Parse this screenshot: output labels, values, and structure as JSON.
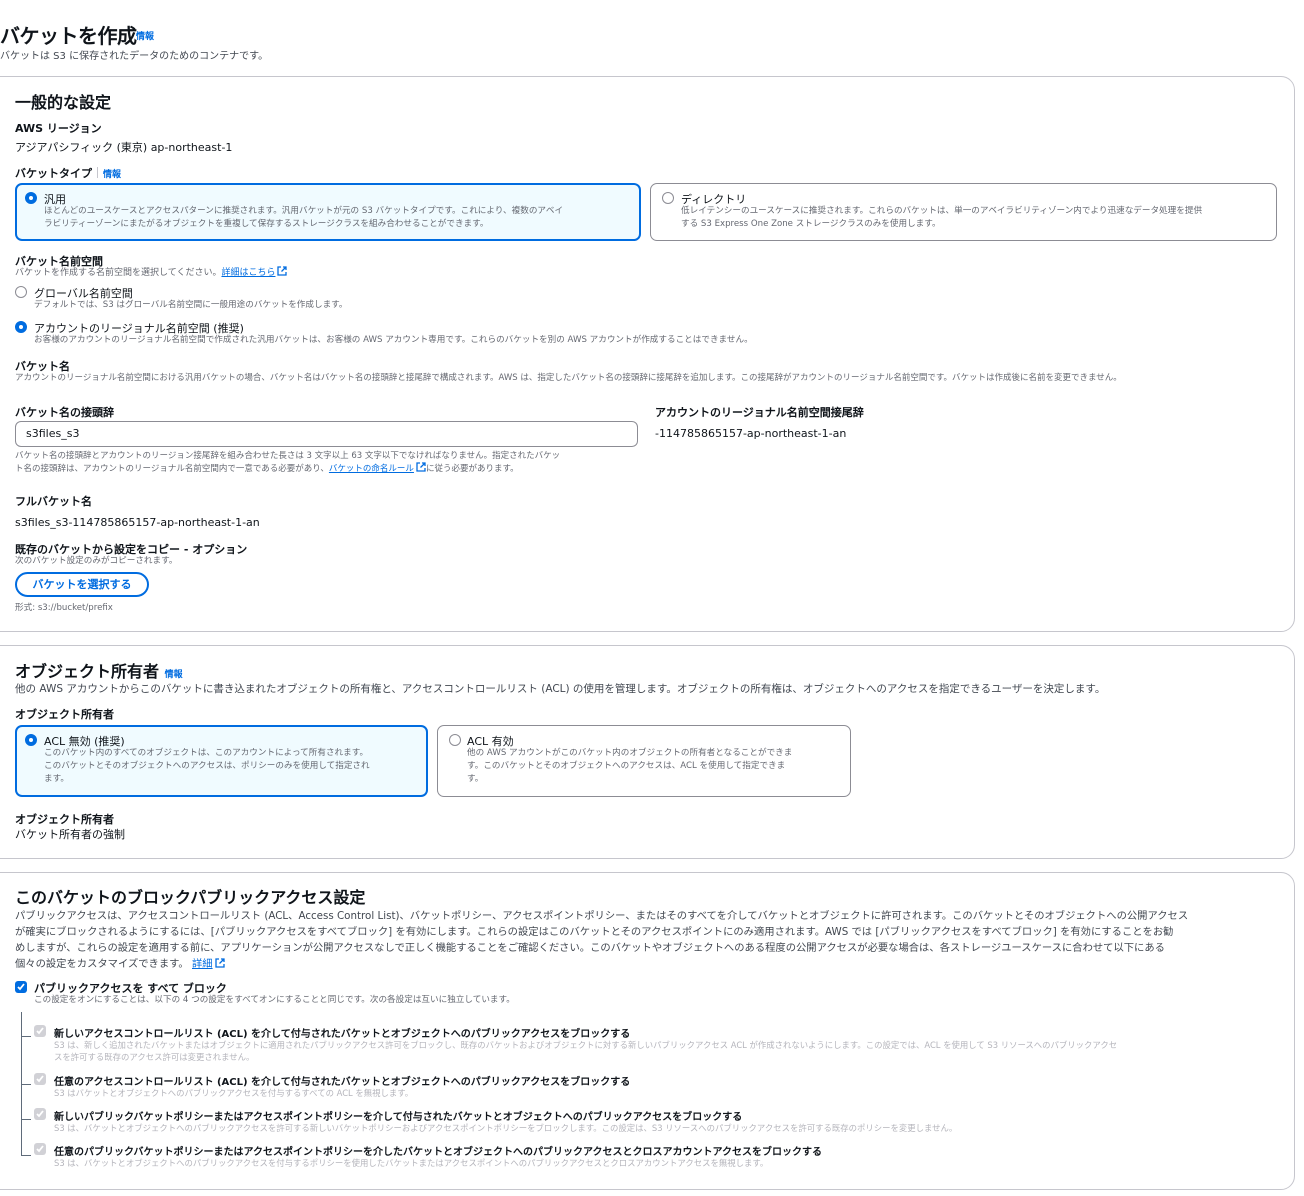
{
  "page": {
    "title": "バケットを作成",
    "info": "情報",
    "subtitle": "バケットは S3 に保存されたデータのためのコンテナです。"
  },
  "general": {
    "heading": "一般的な設定",
    "region_label": "AWS リージョン",
    "region_value": "アジアパシフィック (東京) ap-northeast-1",
    "bucket_type_label": "バケットタイプ",
    "bucket_type_info": "情報",
    "type_general": {
      "title": "汎用",
      "desc1": "ほとんどのユースケースとアクセスパターンに推奨されます。汎用バケットが元の S3 バケットタイプです。これにより、複数のアベイ",
      "desc2": "ラビリティーゾーンにまたがるオブジェクトを重複して保存するストレージクラスを組み合わせることができます。"
    },
    "type_directory": {
      "title": "ディレクトリ",
      "desc1": "低レイテンシーのユースケースに推奨されます。これらのバケットは、単一のアベイラビリティゾーン内でより迅速なデータ処理を提供",
      "desc2": "する S3 Express One Zone ストレージクラスのみを使用します。"
    },
    "namespace_label": "バケット名前空間",
    "namespace_desc": "バケットを作成する名前空間を選択してください。",
    "namespace_link": "詳細はこちら",
    "ns_global_title": "グローバル名前空間",
    "ns_global_desc": "デフォルトでは、S3 はグローバル名前空間に一般用途のバケットを作成します。",
    "ns_account_title": "アカウントのリージョナル名前空間 (推奨)",
    "ns_account_desc": "お客様のアカウントのリージョナル名前空間で作成された汎用バケットは、お客様の AWS アカウント専用です。これらのバケットを別の AWS アカウントが作成することはできません。",
    "bucket_name_label": "バケット名",
    "bucket_name_desc": "アカウントのリージョナル名前空間における汎用バケットの場合、バケット名はバケット名の接頭辞と接尾辞で構成されます。AWS は、指定したバケット名の接頭辞に接尾辞を追加します。この接尾辞がアカウントのリージョナル名前空間です。バケットは作成後に名前を変更できません。",
    "prefix_label": "バケット名の接頭辞",
    "prefix_value": "s3files_s3",
    "prefix_help1": "バケット名の接頭辞とアカウントのリージョン接尾辞を組み合わせた長さは 3 文字以上 63 文字以下でなければなりません。指定されたバケッ",
    "prefix_help2a": "ト名の接頭辞は、アカウントのリージョナル名前空間内で一意である必要があり、",
    "prefix_help_link": "バケットの命名ルール",
    "prefix_help2b": "に従う必要があります。",
    "suffix_label": "アカウントのリージョナル名前空間接尾辞",
    "suffix_value": "-114785865157-ap-northeast-1-an",
    "full_name_label": "フルバケット名",
    "full_name_value": "s3files_s3-114785865157-ap-northeast-1-an",
    "copy_label": "既存のバケットから設定をコピー - オプション",
    "copy_desc": "次のバケット設定のみがコピーされます。",
    "choose_bucket_button": "バケットを選択する",
    "format_hint": "形式: s3://bucket/prefix"
  },
  "ownership": {
    "heading": "オブジェクト所有者",
    "info": "情報",
    "desc": "他の AWS アカウントからこのバケットに書き込まれたオブジェクトの所有権と、アクセスコントロールリスト (ACL) の使用を管理します。オブジェクトの所有権は、オブジェクトへのアクセスを指定できるユーザーを決定します。",
    "label": "オブジェクト所有者",
    "acl_disabled": {
      "title": "ACL 無効 (推奨)",
      "desc1": "このバケット内のすべてのオブジェクトは、このアカウントによって所有されます。",
      "desc2": "このバケットとそのオブジェクトへのアクセスは、ポリシーのみを使用して指定され",
      "desc3": "ます。"
    },
    "acl_enabled": {
      "title": "ACL 有効",
      "desc1": "他の AWS アカウントがこのバケット内のオブジェクトの所有者となることができま",
      "desc2": "す。このバケットとそのオブジェクトへのアクセスは、ACL を使用して指定できま",
      "desc3": "す。"
    },
    "owner_label": "オブジェクト所有者",
    "owner_value": "バケット所有者の強制"
  },
  "block": {
    "heading": "このバケットのブロックパブリックアクセス設定",
    "desc1": "パブリックアクセスは、アクセスコントロールリスト (ACL、Access Control List)、バケットポリシー、アクセスポイントポリシー、またはそのすべてを介してバケットとオブジェクトに許可されます。このバケットとそのオブジェクトへの公開アクセス",
    "desc2": "が確実にブロックされるようにするには、[パブリックアクセスをすべてブロック] を有効にします。これらの設定はこのバケットとそのアクセスポイントにのみ適用されます。AWS では [パブリックアクセスをすべてブロック] を有効にすることをお勧",
    "desc3": "めしますが、これらの設定を適用する前に、アプリケーションが公開アクセスなしで正しく機能することをご確認ください。このバケットやオブジェクトへのある程度の公開アクセスが必要な場合は、各ストレージユースケースに合わせて以下にある",
    "desc4": "個々の設定をカスタマイズできます。",
    "desc_link": "詳細",
    "all_title": "パブリックアクセスを すべて ブロック",
    "all_desc": "この設定をオンにすることは、以下の 4 つの設定をすべてオンにすることと同じです。次の各設定は互いに独立しています。",
    "opt1_title": "新しいアクセスコントロールリスト (ACL) を介して付与されたバケットとオブジェクトへのパブリックアクセスをブロックする",
    "opt1_desc1": "S3 は、新しく追加されたバケットまたはオブジェクトに適用されたパブリックアクセス許可をブロックし、既存のバケットおよびオブジェクトに対する新しいパブリックアクセス ACL が作成されないようにします。この設定では、ACL を使用して S3 リソースへのパブリックアクセ",
    "opt1_desc2": "スを許可する既存のアクセス許可は変更されません。",
    "opt2_title": "任意のアクセスコントロールリスト (ACL) を介して付与されたバケットとオブジェクトへのパブリックアクセスをブロックする",
    "opt2_desc": "S3 はバケットとオブジェクトへのパブリックアクセスを付与するすべての ACL を無視します。",
    "opt3_title": "新しいパブリックバケットポリシーまたはアクセスポイントポリシーを介して付与されたバケットとオブジェクトへのパブリックアクセスをブロックする",
    "opt3_desc": "S3 は、バケットとオブジェクトへのパブリックアクセスを許可する新しいバケットポリシーおよびアクセスポイントポリシーをブロックします。この設定は、S3 リソースへのパブリックアクセスを許可する既存のポリシーを変更しません。",
    "opt4_title": "任意のパブリックバケットポリシーまたはアクセスポイントポリシーを介したバケットとオブジェクトへのパブリックアクセスとクロスアカウントアクセスをブロックする",
    "opt4_desc": "S3 は、バケットとオブジェクトへのパブリックアクセスを付与するポリシーを使用したバケットまたはアクセスポイントへのパブリックアクセスとクロスアカウントアクセスを無視します。"
  },
  "colors": {
    "accent": "#006ce0",
    "selected_tile_bg": "#f0fbff",
    "border": "#c6c6cd",
    "muted_text": "#656871",
    "disabled": "#d1d1d6"
  }
}
